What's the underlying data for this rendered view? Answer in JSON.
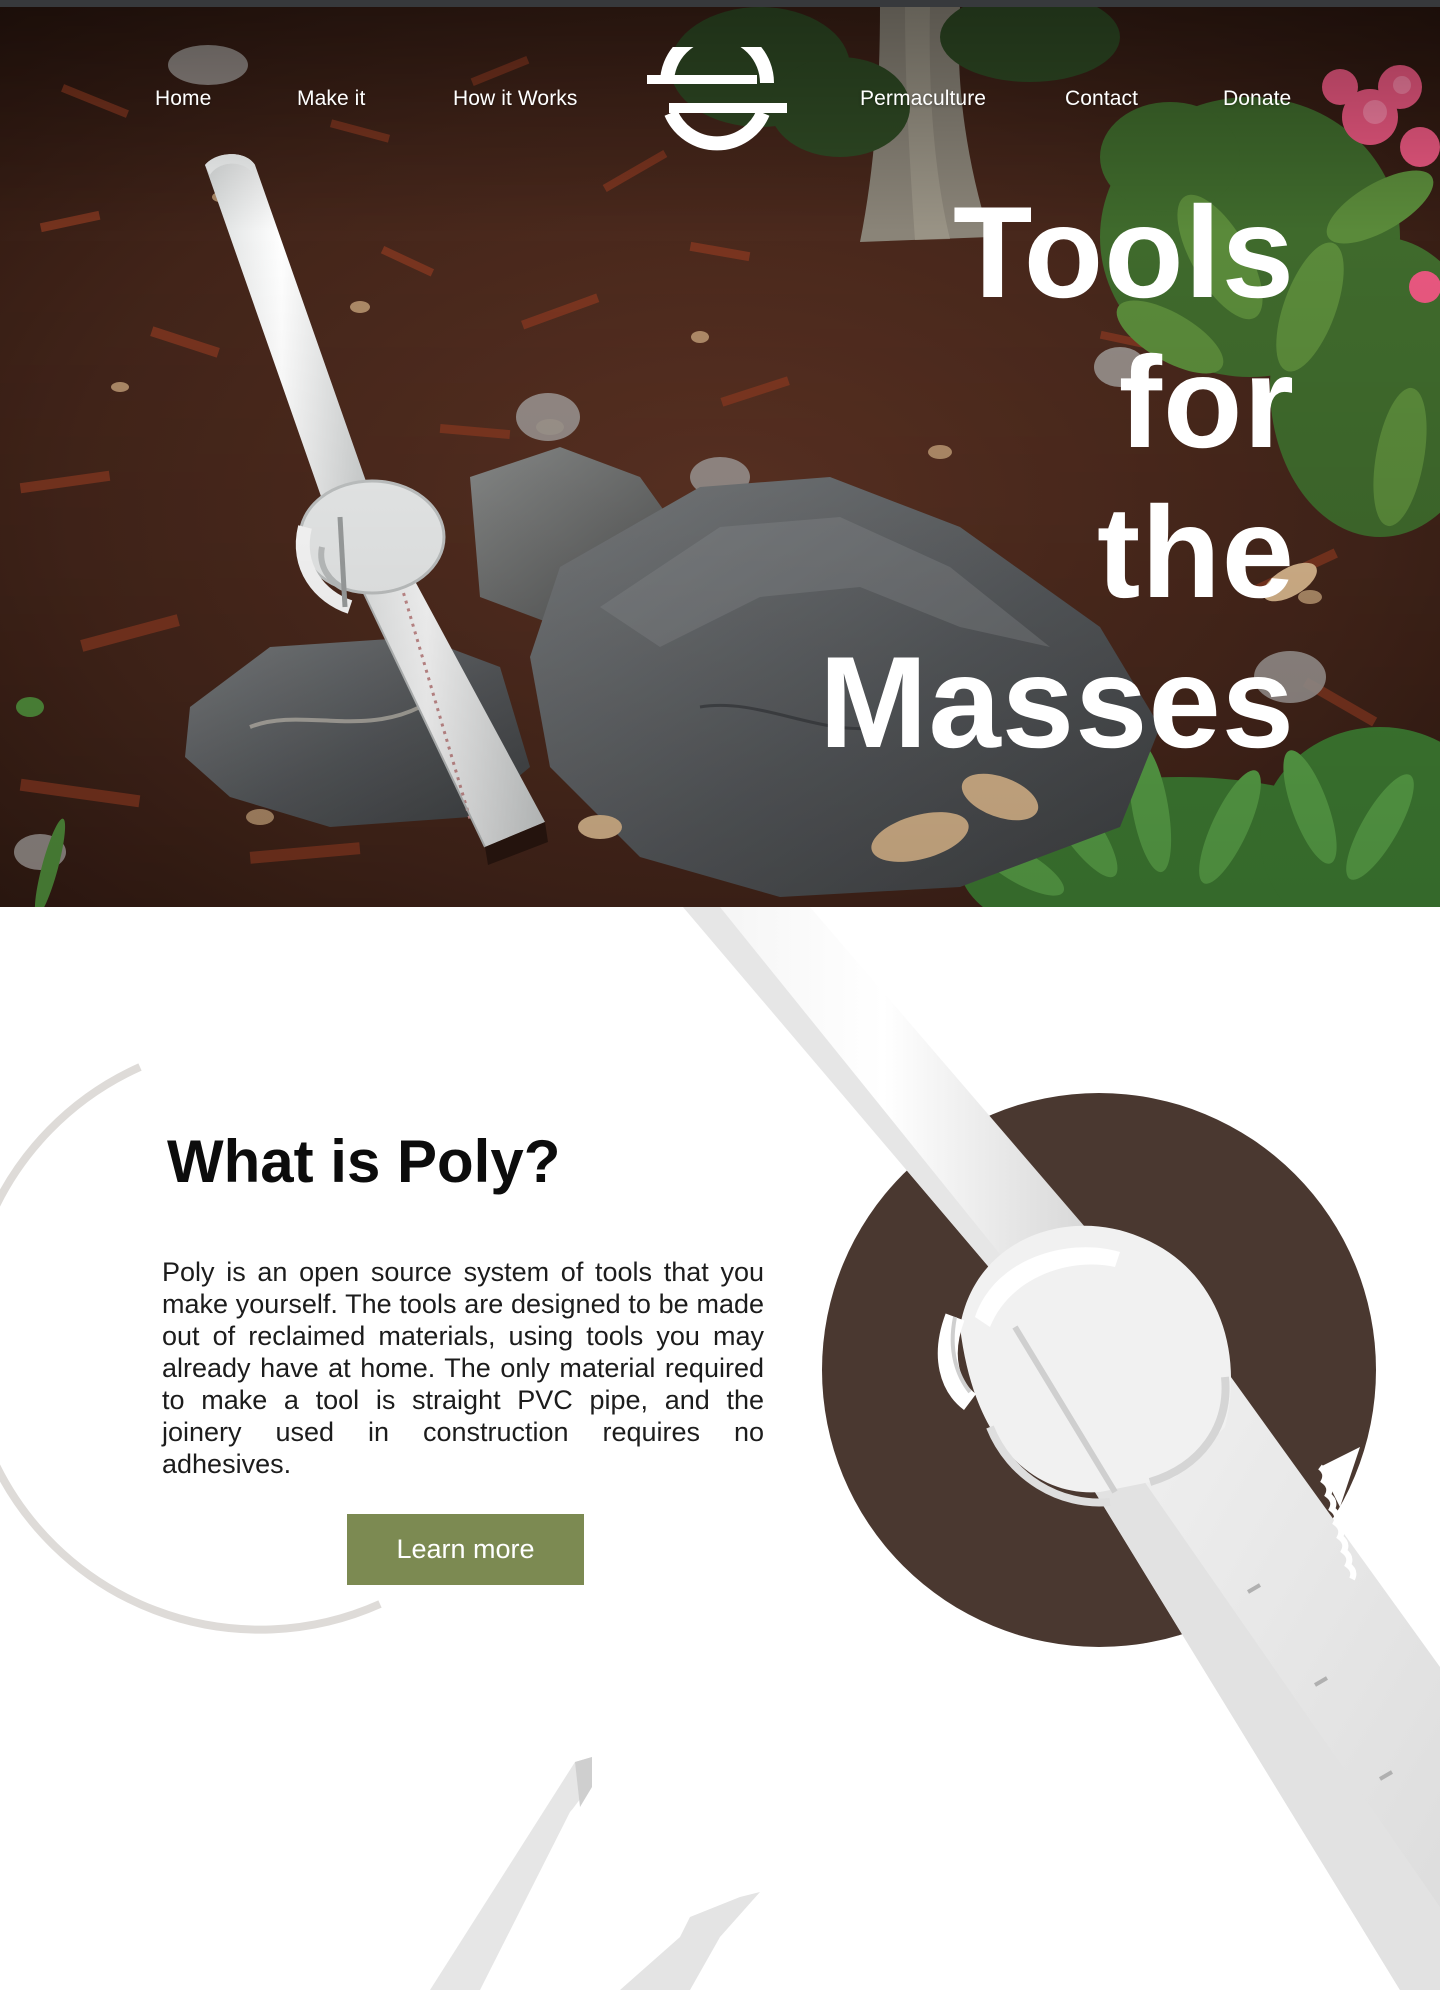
{
  "nav": {
    "items": [
      {
        "label": "Home"
      },
      {
        "label": "Make it"
      },
      {
        "label": "How it Works"
      },
      {
        "label": "Permaculture"
      },
      {
        "label": "Contact"
      },
      {
        "label": "Donate"
      }
    ]
  },
  "hero": {
    "headline_lines": [
      "Tools",
      "for",
      "the",
      "Masses"
    ]
  },
  "about": {
    "title": "What is Poly?",
    "body": "Poly is an open source system of tools that you make yourself. The tools are designed to be made out of reclaimed materials, using tools you may already have at home. The only material required to make a tool is straight PVC pipe, and the joinery used in construction requires no adhesives.",
    "cta_label": "Learn more"
  },
  "colors": {
    "accent_button": "#7c8a52",
    "brown_circle": "#4a3830",
    "top_bar": "#37393c"
  },
  "icons": {
    "logo": "poly-logo-icon"
  }
}
